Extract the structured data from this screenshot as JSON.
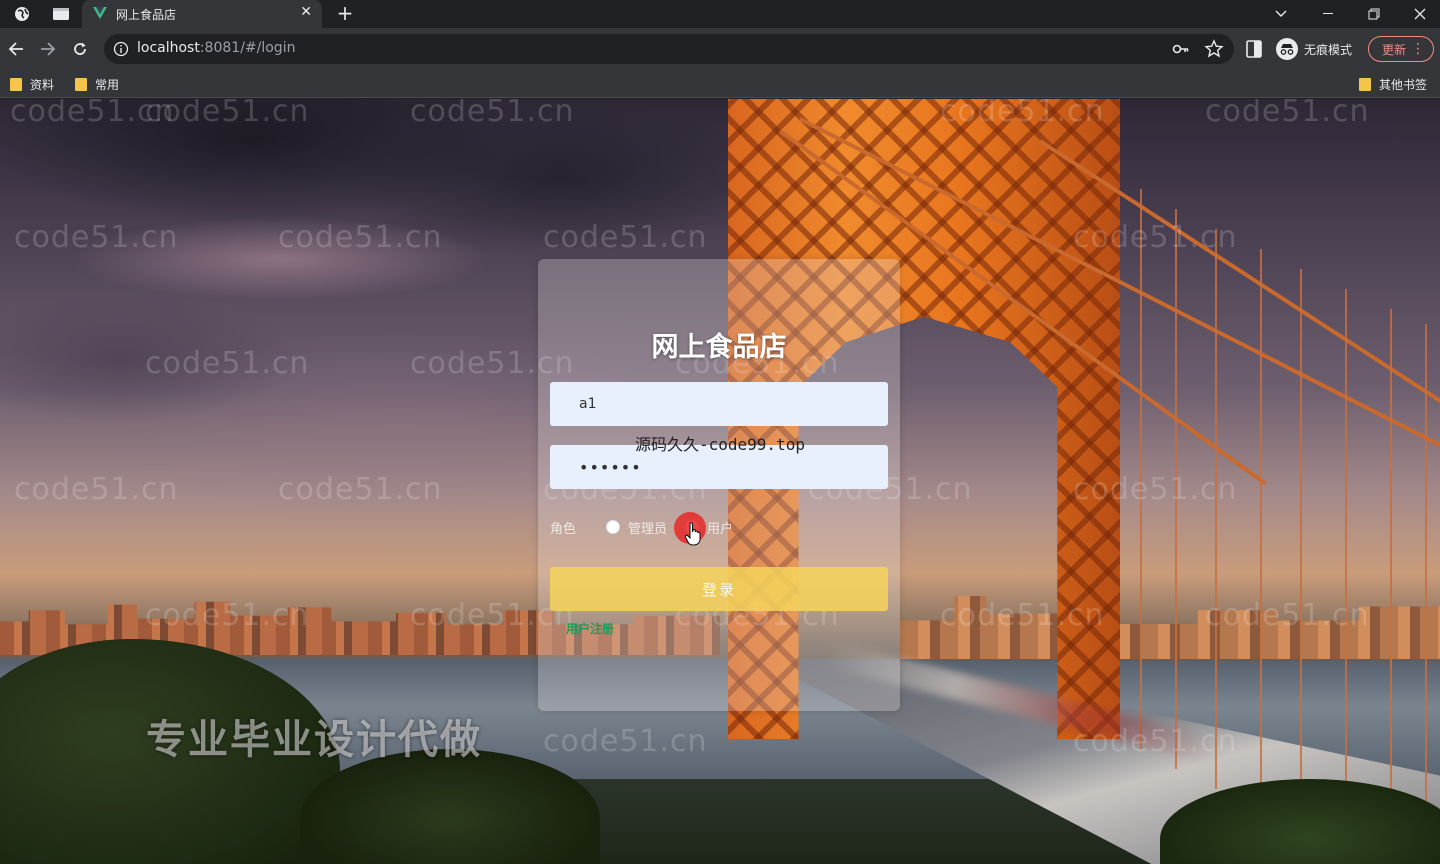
{
  "browser": {
    "tab": {
      "title": "网上食品店"
    },
    "address": {
      "host": "localhost",
      "rest": ":8081/#/login"
    },
    "incognito_label": "无痕模式",
    "update_label": "更新",
    "bookmarks": [
      {
        "label": "资料"
      },
      {
        "label": "常用"
      }
    ],
    "other_bookmarks_label": "其他书签"
  },
  "watermark": {
    "text": "code51.cn"
  },
  "overlay_tag": "源码久久-code99.top",
  "promo_text": "专业毕业设计代做",
  "login": {
    "title": "网上食品店",
    "username_value": "a1",
    "password_value": "••••••",
    "role_label": "角色",
    "roles": [
      {
        "label": "管理员"
      },
      {
        "label": "用户"
      }
    ],
    "submit_label": "登录",
    "register_label": "用户注册"
  },
  "colors": {
    "accent": "#f5d45a",
    "link": "#16a05d",
    "click_marker": "#e62828"
  }
}
